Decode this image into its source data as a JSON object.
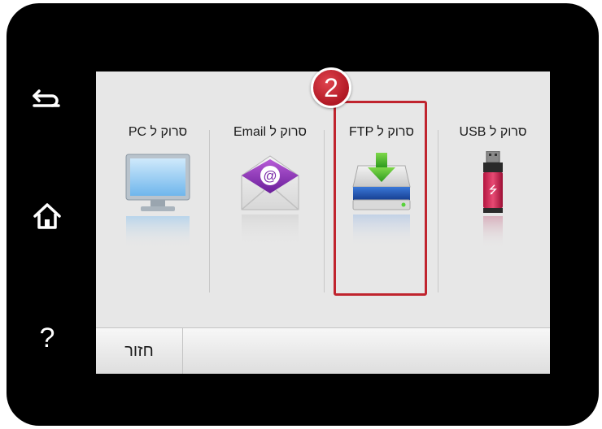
{
  "sidebar": {
    "help_label": "?"
  },
  "callout": {
    "step_number": "2"
  },
  "tiles": [
    {
      "label": "PC סרוק ל",
      "icon": "monitor-icon"
    },
    {
      "label": "Email סרוק ל",
      "icon": "email-icon"
    },
    {
      "label": "FTP סרוק ל",
      "icon": "ftp-drive-icon"
    },
    {
      "label": "USB סרוק ל",
      "icon": "usb-drive-icon"
    }
  ],
  "bottom_bar": {
    "back_label": "חזור"
  },
  "colors": {
    "device": "#000000",
    "screen": "#e7e7e7",
    "highlight": "#c0242e"
  }
}
